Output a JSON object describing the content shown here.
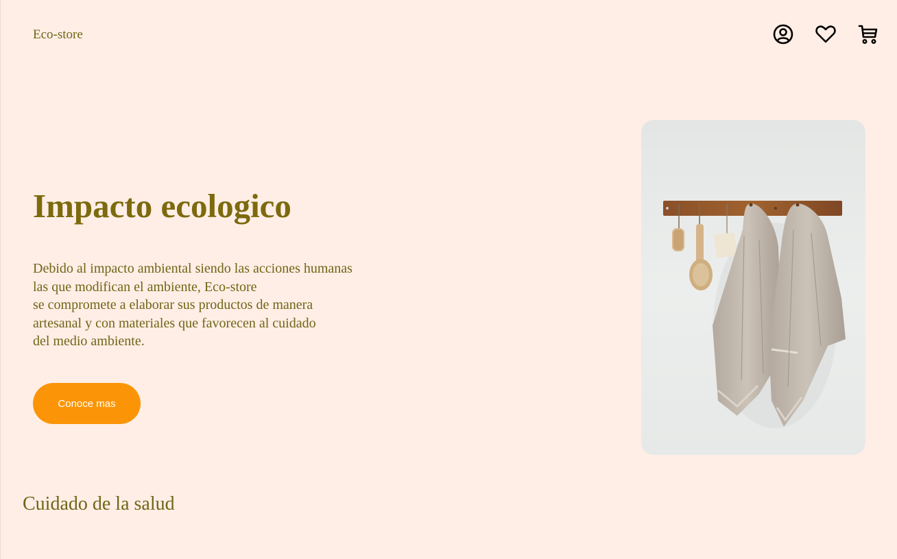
{
  "header": {
    "logo": "Eco-store",
    "icons": [
      "user-icon",
      "heart-icon",
      "cart-icon"
    ]
  },
  "hero": {
    "title": "Impacto ecologico",
    "paragraph_lines": [
      "Debido al impacto ambiental siendo las acciones humanas",
      "las que modifican el ambiente, Eco-store",
      "se compromete a elaborar sus productos de manera",
      "artesanal y con materiales que favorecen al cuidado",
      "del medio ambiente."
    ],
    "button_label": "Conoce mas"
  },
  "section": {
    "title": "Cuidado de la salud"
  },
  "colors": {
    "background": "#ffeee6",
    "title": "#7c6a0d",
    "text": "#6f6515",
    "button": "#fb9507",
    "button_text": "#ffffff"
  }
}
